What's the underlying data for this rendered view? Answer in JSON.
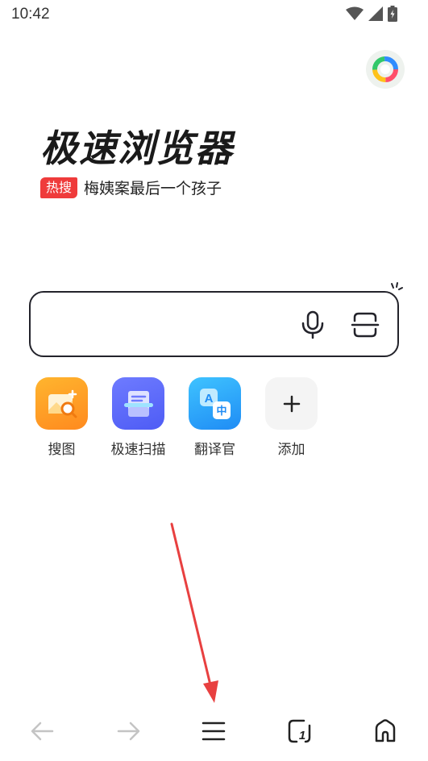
{
  "status_bar": {
    "time": "10:42",
    "icons": [
      "wifi-icon",
      "signal-icon",
      "battery-icon"
    ]
  },
  "brand": {
    "title": "极速浏览器"
  },
  "hot_search": {
    "badge": "热搜",
    "text": "梅姨案最后一个孩子"
  },
  "search": {
    "placeholder": "",
    "icons": [
      "microphone-icon",
      "scan-icon"
    ]
  },
  "shortcuts": [
    {
      "label": "搜图",
      "icon": "image-search-icon"
    },
    {
      "label": "极速扫描",
      "icon": "document-scan-icon"
    },
    {
      "label": "翻译官",
      "icon": "translate-icon"
    },
    {
      "label": "添加",
      "icon": "plus-icon"
    }
  ],
  "bottom_nav": {
    "items": [
      "back-arrow-icon",
      "forward-arrow-icon",
      "menu-icon",
      "tabs-icon",
      "home-icon"
    ],
    "tab_count": "1"
  },
  "colors": {
    "hot_badge": "#ef3b3b",
    "annotation_arrow": "#e84040",
    "search_border": "#23232b"
  }
}
